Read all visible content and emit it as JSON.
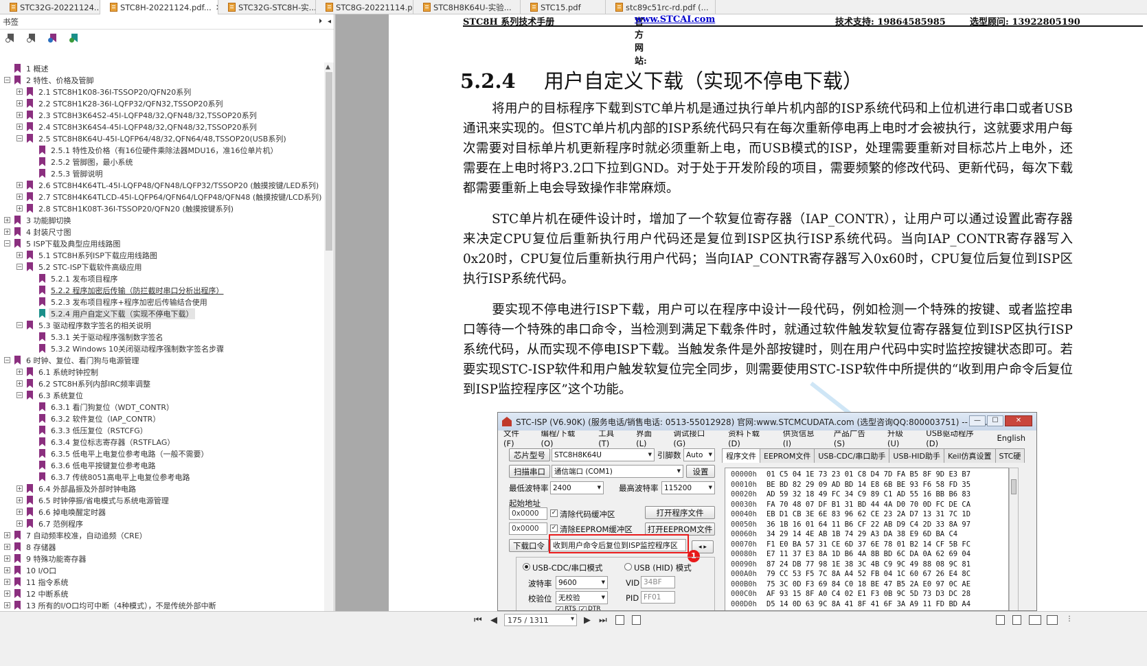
{
  "tabs": [
    {
      "label": "STC32G-20221124...",
      "active": false
    },
    {
      "label": "STC8H-20221124.pdf...",
      "active": true
    },
    {
      "label": "STC32G-STC8H-实...",
      "active": false
    },
    {
      "label": "STC8G-20221114.p...",
      "active": false
    },
    {
      "label": "STC8H8K64U-实验...",
      "active": false
    },
    {
      "label": "STC15.pdf",
      "active": false
    },
    {
      "label": "stc89c51rc-rd.pdf (...",
      "active": false
    }
  ],
  "tab_close_glyph": "✕",
  "panel": {
    "title": "书签",
    "collapse_glyph": "⏵",
    "left_glyph": "◂"
  },
  "bookmarks": [
    {
      "label": "1 概述",
      "level": 0,
      "toggle": "",
      "color": "purple"
    },
    {
      "label": "2 特性、价格及管脚",
      "level": 0,
      "toggle": "−",
      "color": "purple"
    },
    {
      "label": "2.1 STC8H1K08-36I-TSSOP20/QFN20系列",
      "level": 1,
      "toggle": "+",
      "color": "purple"
    },
    {
      "label": "2.2 STC8H1K28-36I-LQFP32/QFN32,TSSOP20系列",
      "level": 1,
      "toggle": "+",
      "color": "purple"
    },
    {
      "label": "2.3 STC8H3K64S2-45I-LQFP48/32,QFN48/32,TSSOP20系列",
      "level": 1,
      "toggle": "+",
      "color": "purple"
    },
    {
      "label": "2.4 STC8H3K64S4-45I-LQFP48/32,QFN48/32,TSSOP20系列",
      "level": 1,
      "toggle": "+",
      "color": "purple"
    },
    {
      "label": "2.5 STC8H8K64U-45I-LQFP64/48/32,QFN64/48,TSSOP20(USB系列)",
      "level": 1,
      "toggle": "−",
      "color": "purple"
    },
    {
      "label": "2.5.1 特性及价格（有16位硬件乘除法器MDU16，准16位单片机）",
      "level": 2,
      "toggle": "",
      "color": "purple"
    },
    {
      "label": "2.5.2 管脚图，最小系统",
      "level": 2,
      "toggle": "",
      "color": "purple"
    },
    {
      "label": "2.5.3 管脚说明",
      "level": 2,
      "toggle": "",
      "color": "purple"
    },
    {
      "label": "2.6 STC8H4K64TL-45I-LQFP48/QFN48/LQFP32/TSSOP20 (触摸按键/LED系列)",
      "level": 1,
      "toggle": "+",
      "color": "purple"
    },
    {
      "label": "2.7 STC8H4K64TLCD-45I-LQFP64/QFN64/LQFP48/QFN48 (触摸按键/LCD系列)",
      "level": 1,
      "toggle": "+",
      "color": "purple"
    },
    {
      "label": "2.8 STC8H1K08T-36I-TSSOP20/QFN20 (触摸按键系列)",
      "level": 1,
      "toggle": "+",
      "color": "purple"
    },
    {
      "label": "3 功能脚切换",
      "level": 0,
      "toggle": "+",
      "color": "purple"
    },
    {
      "label": "4 封装尺寸图",
      "level": 0,
      "toggle": "+",
      "color": "purple"
    },
    {
      "label": "5 ISP下载及典型应用线路图",
      "level": 0,
      "toggle": "−",
      "color": "purple"
    },
    {
      "label": "5.1 STC8H系列ISP下载应用线路图",
      "level": 1,
      "toggle": "+",
      "color": "purple"
    },
    {
      "label": "5.2 STC-ISP下载软件高级应用",
      "level": 1,
      "toggle": "−",
      "color": "purple"
    },
    {
      "label": "5.2.1 发布项目程序",
      "level": 2,
      "toggle": "",
      "color": "purple"
    },
    {
      "label": "5.2.2 程序加密后传输（防拦截时串口分析出程序）",
      "level": 2,
      "toggle": "",
      "color": "purple",
      "underline": true
    },
    {
      "label": "5.2.3 发布项目程序+程序加密后传输结合使用",
      "level": 2,
      "toggle": "",
      "color": "purple"
    },
    {
      "label": "5.2.4 用户自定义下载（实现不停电下载）",
      "level": 2,
      "toggle": "",
      "color": "teal",
      "selected": true
    },
    {
      "label": "5.3 驱动程序数字签名的相关说明",
      "level": 1,
      "toggle": "−",
      "color": "purple"
    },
    {
      "label": "5.3.1 关于驱动程序强制数字签名",
      "level": 2,
      "toggle": "",
      "color": "purple"
    },
    {
      "label": "5.3.2 Windows 10关闭驱动程序强制数字签名步骤",
      "level": 2,
      "toggle": "",
      "color": "purple"
    },
    {
      "label": "6 时钟、复位、看门狗与电源管理",
      "level": 0,
      "toggle": "−",
      "color": "purple"
    },
    {
      "label": "6.1 系统时钟控制",
      "level": 1,
      "toggle": "+",
      "color": "purple"
    },
    {
      "label": "6.2 STC8H系列内部IRC频率调整",
      "level": 1,
      "toggle": "+",
      "color": "purple"
    },
    {
      "label": "6.3 系统复位",
      "level": 1,
      "toggle": "−",
      "color": "purple"
    },
    {
      "label": "6.3.1 看门狗复位（WDT_CONTR）",
      "level": 2,
      "toggle": "",
      "color": "purple"
    },
    {
      "label": "6.3.2 软件复位（IAP_CONTR）",
      "level": 2,
      "toggle": "",
      "color": "purple"
    },
    {
      "label": "6.3.3 低压复位（RSTCFG）",
      "level": 2,
      "toggle": "",
      "color": "purple"
    },
    {
      "label": "6.3.4 复位标志寄存器（RSTFLAG）",
      "level": 2,
      "toggle": "",
      "color": "purple"
    },
    {
      "label": "6.3.5 低电平上电复位参考电路（一般不需要）",
      "level": 2,
      "toggle": "",
      "color": "purple"
    },
    {
      "label": "6.3.6 低电平按键复位参考电路",
      "level": 2,
      "toggle": "",
      "color": "purple"
    },
    {
      "label": "6.3.7 传统8051高电平上电复位参考电路",
      "level": 2,
      "toggle": "",
      "color": "purple"
    },
    {
      "label": "6.4 外部晶振及外部时钟电路",
      "level": 1,
      "toggle": "+",
      "color": "purple"
    },
    {
      "label": "6.5 时钟停振/省电模式与系统电源管理",
      "level": 1,
      "toggle": "+",
      "color": "purple"
    },
    {
      "label": "6.6 掉电唤醒定时器",
      "level": 1,
      "toggle": "+",
      "color": "purple"
    },
    {
      "label": "6.7 范例程序",
      "level": 1,
      "toggle": "+",
      "color": "purple"
    },
    {
      "label": "7 自动频率校准，自动追频（CRE）",
      "level": 0,
      "toggle": "+",
      "color": "purple"
    },
    {
      "label": "8 存储器",
      "level": 0,
      "toggle": "+",
      "color": "purple"
    },
    {
      "label": "9 特殊功能寄存器",
      "level": 0,
      "toggle": "+",
      "color": "purple"
    },
    {
      "label": "10 I/O口",
      "level": 0,
      "toggle": "+",
      "color": "purple"
    },
    {
      "label": "11 指令系统",
      "level": 0,
      "toggle": "+",
      "color": "purple"
    },
    {
      "label": "12 中断系统",
      "level": 0,
      "toggle": "+",
      "color": "purple"
    },
    {
      "label": "13 所有的I/O口均可中断（4种模式），不是传统外部中断",
      "level": 0,
      "toggle": "+",
      "color": "purple"
    },
    {
      "label": "14 定时器/计数器",
      "level": 0,
      "toggle": "+",
      "color": "purple"
    }
  ],
  "page_header": {
    "manual": "STC8H 系列技术手册",
    "site_label": "官方网站: ",
    "site_link": "www.STCAI.com",
    "support": "技术支持: 19864585985",
    "sales": "选型顾问: 13922805190"
  },
  "section": {
    "number": "5.2.4",
    "title": "用户自定义下载（实现不停电下载）"
  },
  "paragraphs": [
    "将用户的目标程序下载到STC单片机是通过执行单片机内部的ISP系统代码和上位机进行串口或者USB通讯来实现的。但STC单片机内部的ISP系统代码只有在每次重新停电再上电时才会被执行，这就要求用户每次需要对目标单片机更新程序时就必须重新上电，而USB模式的ISP，处理需要重新对目标芯片上电外，还需要在上电时将P3.2口下拉到GND。对于处于开发阶段的项目，需要频繁的修改代码、更新代码，每次下载都需要重新上电会导致操作非常麻烦。",
    "STC单片机在硬件设计时，增加了一个软复位寄存器（IAP_CONTR），让用户可以通过设置此寄存器来决定CPU复位后重新执行用户代码还是复位到ISP区执行ISP系统代码。当向IAP_CONTR寄存器写入0x20时，CPU复位后重新执行用户代码；当向IAP_CONTR寄存器写入0x60时，CPU复位后复位到ISP区执行ISP系统代码。",
    "要实现不停电进行ISP下载，用户可以在程序中设计一段代码，例如检测一个特殊的按键、或者监控串口等待一个特殊的串口命令，当检测到满足下载条件时，就通过软件触发软复位寄存器复位到ISP区执行ISP系统代码，从而实现不停电ISP下载。当触发条件是外部按键时，则在用户代码中实时监控按键状态即可。若要实现STC-ISP软件和用户触发软复位完全同步，则需要使用STC-ISP软件中所提供的“收到用户命令后复位到ISP监控程序区”这个功能。"
  ],
  "isp": {
    "title": "STC-ISP (V6.90K) (服务电话/销售电话: 0513-55012928) 官网:www.STCMCUDATA.com (选型咨询QQ:800003751) -- ST...",
    "win_min": "—",
    "win_max": "☐",
    "win_close": "✕",
    "menu": [
      "文件(F)",
      "编程/下载(O)",
      "工具(T)",
      "界面(L)",
      "调试接口(G)",
      "资料下载(D)",
      "供货信息(I)",
      "产品广告(S)",
      "升级(U)",
      "USB驱动程序(D)",
      "English"
    ],
    "chip_label": "芯片型号",
    "chip_value": "STC8H8K64U",
    "pin_label": "引脚数",
    "pin_value": "Auto",
    "scan_label": "扫描串口",
    "port_value": "通信端口 (COM1)",
    "settings_label": "设置",
    "min_baud_label": "最低波特率",
    "min_baud_value": "2400",
    "max_baud_label": "最高波特率",
    "max_baud_value": "115200",
    "start_addr_label": "起始地址",
    "addr1": "0x0000",
    "clear_code": "清除代码缓冲区",
    "open_prog": "打开程序文件",
    "addr2": "0x0000",
    "clear_eeprom": "清除EEPROM缓冲区",
    "open_eeprom": "打开EEPROM文件",
    "download_cmd": "下载口令",
    "user_cmd": "收到用户命令后复位到ISP监控程序区",
    "arrows": "◂ ▸",
    "badge": "1",
    "usb_cdc_mode": "USB-CDC/串口模式",
    "usb_hid_mode": "USB (HID) 模式",
    "baud_label": "波特率",
    "baud_value": "9600",
    "parity_label": "校验位",
    "parity_value": "无校验",
    "vid_label": "VID",
    "vid_value": "34BF",
    "pid_label": "PID",
    "pid_value": "FF01",
    "rts_label": "RTS",
    "dtr_label": "DTR",
    "tabs": [
      "程序文件",
      "EEPROM文件",
      "USB-CDC/串口助手",
      "USB-HID助手",
      "Keil仿真设置",
      "STC硬"
    ],
    "hex": [
      {
        "addr": "00000h",
        "bytes": "01 C5 04 1E 73 23 01 C8 D4 7D FA B5 8F 9D E3 B7"
      },
      {
        "addr": "00010h",
        "bytes": "BE BD 82 29 09 AD BD 14 E8 6B BE 93 F6 58 FD 35"
      },
      {
        "addr": "00020h",
        "bytes": "AD 59 32 18 49 FC 34 C9 89 C1 AD 55 16 BB B6 83"
      },
      {
        "addr": "00030h",
        "bytes": "FA 70 48 07 DF B1 31 BD 44 4A D0 70 0D FC DE CA"
      },
      {
        "addr": "00040h",
        "bytes": "EB D1 CB 3E 6E 83 96 62 CE 23 2A D7 13 31 7C 1D"
      },
      {
        "addr": "00050h",
        "bytes": "36 1B 16 01 64 11 B6 CF 22 AB D9 C4 2D 33 8A 97"
      },
      {
        "addr": "00060h",
        "bytes": "34 29 14 4E AB 1B 74 29 A3 DA 38 E9 6D BA C4 "
      },
      {
        "addr": "00070h",
        "bytes": "F1 E0 BA 57 31 CE 6D 37 6E 78 01 B2 14 CF 5B FC"
      },
      {
        "addr": "00080h",
        "bytes": "E7 11 37 E3 8A 1D B6 4A 8B BD 6C DA 0A 62 69 04"
      },
      {
        "addr": "00090h",
        "bytes": "87 24 DB 77 98 1E 38 3C 4B C9 9C 49 88 08 9C 81"
      },
      {
        "addr": "000A0h",
        "bytes": "79 CC 53 F5 7C 8A A4 52 FB 04 1C 60 67 26 E4 8C"
      },
      {
        "addr": "000B0h",
        "bytes": "75 3C 0D F3 69 84 C0 18 BE 47 B5 2A E0 97 0C AE"
      },
      {
        "addr": "000C0h",
        "bytes": "AF 93 15 8F A0 C4 02 E1 F3 0B 9C 5D 73 D3 DC 28"
      },
      {
        "addr": "000D0h",
        "bytes": "D5 14 0D 63 9C 8A 41 8F 41 6F 3A A9 11 FD BD A4"
      }
    ]
  },
  "navbar": {
    "page_value": "175 / 1311",
    "first": "⏮",
    "prev": "◀",
    "next": "▶",
    "last": "⏭"
  }
}
